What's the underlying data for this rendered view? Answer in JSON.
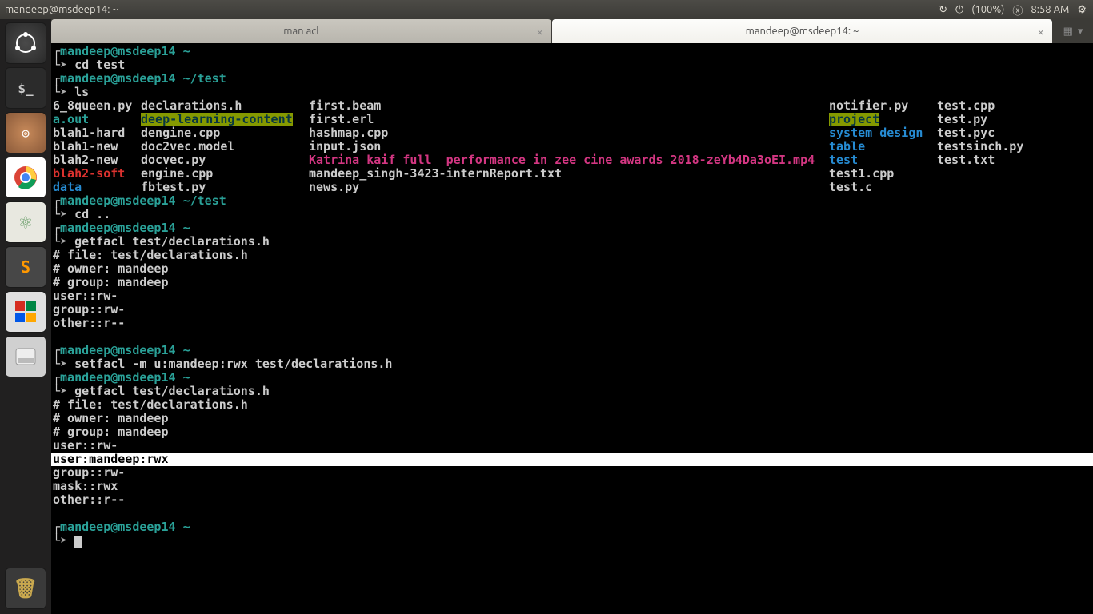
{
  "topbar": {
    "title": "mandeep@msdeep14: ~",
    "battery": "(100%)",
    "time": "8:58 AM"
  },
  "tabs": {
    "t1": "man acl",
    "t2": "mandeep@msdeep14: ~"
  },
  "prompt": {
    "user": "mandeep",
    "host": "msdeep14",
    "home": "~",
    "test": "~/test",
    "arrow": "➤"
  },
  "cmd": {
    "cd_test": "cd test",
    "ls": "ls",
    "cd_up": "cd ..",
    "getfacl": "getfacl test/declarations.h",
    "setfacl": "setfacl -m u:mandeep:rwx test/declarations.h"
  },
  "ls": {
    "c1r1": "6_8queen.py",
    "c2r1": "declarations.h",
    "c3r1": "first.beam",
    "c4r1": "notifier.py",
    "c5r1": "test.cpp",
    "c1r2": "a.out",
    "c2r2": "deep-learning-content",
    "c3r2": "first.erl",
    "c4r2": "project",
    "c5r2": "test.py",
    "c1r3": "blah1-hard",
    "c2r3": "dengine.cpp",
    "c3r3": "hashmap.cpp",
    "c4r3": "system design",
    "c5r3": "test.pyc",
    "c1r4": "blah1-new",
    "c2r4": "doc2vec.model",
    "c3r4": "input.json",
    "c4r4": "table",
    "c5r4": "testsinch.py",
    "c1r5": "blah2-new",
    "c2r5": "docvec.py",
    "c3r5": "Katrina kaif full  performance in zee cine awards 2018-zeYb4Da3oEI.mp4",
    "c4r5": "test",
    "c5r5": "test.txt",
    "c1r6": "blah2-soft",
    "c2r6": "engine.cpp",
    "c3r6": "mandeep_singh-3423-internReport.txt",
    "c4r6": "test1.cpp",
    "c1r7": "data",
    "c2r7": "fbtest.py",
    "c3r7": "news.py",
    "c4r7": "test.c"
  },
  "acl1": {
    "file": "# file: test/declarations.h",
    "owner": "# owner: mandeep",
    "group": "# group: mandeep",
    "u": "user::rw-",
    "g": "group::rw-",
    "o": "other::r--"
  },
  "acl2": {
    "file": "# file: test/declarations.h",
    "owner": "# owner: mandeep",
    "group": "# group: mandeep",
    "u": "user::rw-",
    "um": "user:mandeep:rwx",
    "g": "group::rw-",
    "m": "mask::rwx",
    "o": "other::r--"
  }
}
